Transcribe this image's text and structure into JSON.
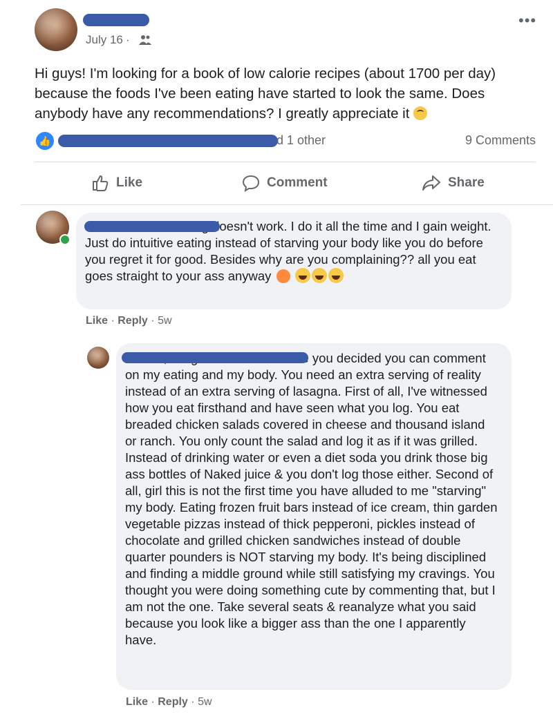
{
  "post": {
    "date": "July 16",
    "separator": "·",
    "audience_icon": "friends-icon",
    "more_icon": "•••",
    "text": "Hi guys! I'm looking for a book of low calorie recipes (about 1700 per day) because the foods I've been eating have started to look the same. Does anybody have any recommendations? I greatly appreciate it",
    "emoji": "upside-down-face",
    "reactions_text": "d 1 other",
    "comment_count": "9 Comments"
  },
  "actions": {
    "like": "Like",
    "comment": "Comment",
    "share": "Share"
  },
  "comments": [
    {
      "text_visible": "n ok. Calorie counting doesn't work. I do it all the time and I gain weight. Just do intuitive eating instead of starving your body like you do before you regret it for good. Besides why are you complaining?? all you eat goes straight to your ass anyway",
      "emojis": [
        "peach",
        "joy",
        "joy",
        "joy"
      ],
      "like": "Like",
      "reply": "Reply",
      "time": "5w"
    },
    {
      "text_visible": "n Look, I'm gonna be blunt since you decided you can comment on my eating and my body. You need an extra serving of reality instead of an extra serving of lasagna. First of all, I've witnessed how you eat firsthand and have seen what you log. You eat breaded chicken salads covered in cheese and thousand island or ranch. You only count the salad and log it as if it was grilled. Instead of drinking water or even a diet soda you drink those big ass bottles of Naked juice & you don't log those either. Second of all, girl this is not the first time you have alluded to me \"starving\" my body. Eating frozen fruit bars instead of ice cream, thin garden vegetable pizzas instead of thick pepperoni, pickles instead of chocolate and grilled chicken sandwiches instead of double quarter pounders is NOT starving my body. It's being disciplined and finding a middle ground while still satisfying my cravings. You thought you were doing something cute by commenting that, but I am not the one. Take several seats & reanalyze what you said because you look like a bigger ass than the one I apparently have.",
      "like": "Like",
      "reply": "Reply",
      "time": "5w"
    }
  ],
  "colors": {
    "redaction": "#3b5aa8",
    "like_blue": "#2d88ff",
    "bubble": "#f0f2f5",
    "meta": "#65676b"
  }
}
